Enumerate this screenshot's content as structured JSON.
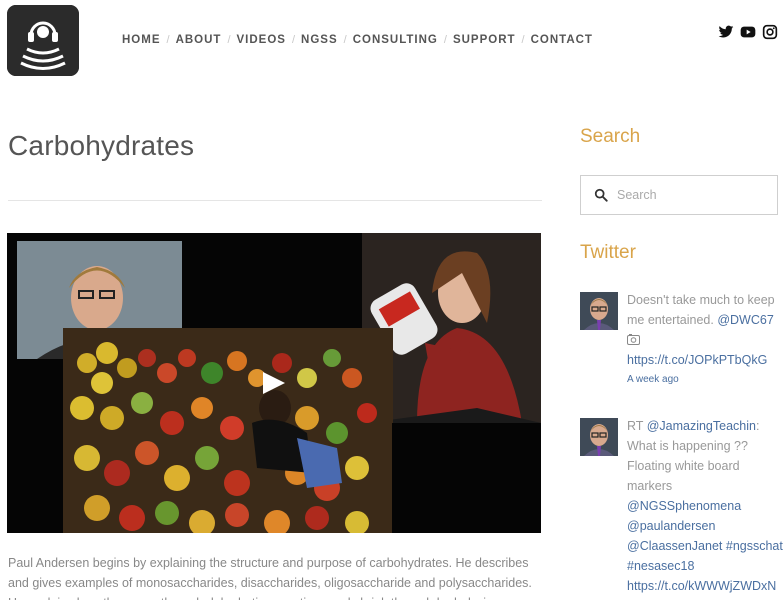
{
  "nav": {
    "items": [
      "HOME",
      "ABOUT",
      "VIDEOS",
      "NGSS",
      "CONSULTING",
      "SUPPORT",
      "CONTACT"
    ]
  },
  "social": [
    "twitter-icon",
    "youtube-icon",
    "instagram-icon"
  ],
  "main": {
    "title": "Carbohydrates",
    "description": "Paul Andersen begins by explaining the structure and purpose of carbohydrates. He describes and gives examples of monosaccharides, disaccharides, oligosaccharide and polysaccharides. He explains how they grow through dehydration reactions and shrink through hydrolysis."
  },
  "sidebar": {
    "search_heading": "Search",
    "search_placeholder": "Search",
    "twitter_heading": "Twitter",
    "tweets": [
      {
        "text": "Doesn't take much to keep me entertained. ",
        "mention": "@DWC67",
        "link": "https://t.co/JOPkPTbQkG",
        "time": "A week ago"
      },
      {
        "prefix": "RT ",
        "mention": "@JamazingTeachin",
        "text": ": What is happening ?? Floating white board markers",
        "mention2": "@NGSSphenomena",
        "mention3": "@paulandersen",
        "mention4": "@ClaassenJanet",
        "hashtag1": "#ngsschat",
        "hashtag2": "#nesasec18",
        "link": "https://t.co/kWWWjZWDxN"
      }
    ]
  },
  "colors": {
    "accent": "#d9a44a",
    "link": "#4a6fa0",
    "logo_bg": "#2b2b2b"
  }
}
